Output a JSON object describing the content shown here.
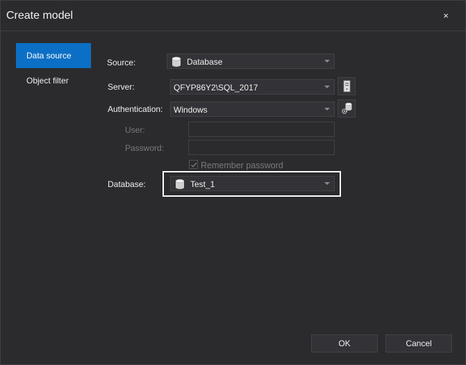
{
  "window": {
    "title": "Create model",
    "close_label": "×"
  },
  "nav": {
    "items": [
      {
        "label": "Data source",
        "active": true
      },
      {
        "label": "Object filter",
        "active": false
      }
    ]
  },
  "form": {
    "source": {
      "label": "Source:",
      "value": "Database",
      "icon": "database-icon"
    },
    "server": {
      "label": "Server:",
      "value": "QFYP86Y2\\SQL_2017",
      "button_icon": "server-icon"
    },
    "authentication": {
      "label": "Authentication:",
      "value": "Windows",
      "button_icon": "database-settings-icon"
    },
    "user": {
      "label": "User:",
      "value": "",
      "enabled": false
    },
    "password": {
      "label": "Password:",
      "value": "",
      "enabled": false
    },
    "remember_password": {
      "label": "Remember password",
      "checked": true,
      "enabled": false
    },
    "database": {
      "label": "Database:",
      "value": "Test_1",
      "icon": "database-icon"
    }
  },
  "footer": {
    "ok_label": "OK",
    "cancel_label": "Cancel"
  },
  "colors": {
    "accent": "#0b6fc6",
    "background": "#2b2b2e",
    "field": "#333337",
    "border": "#434346"
  }
}
